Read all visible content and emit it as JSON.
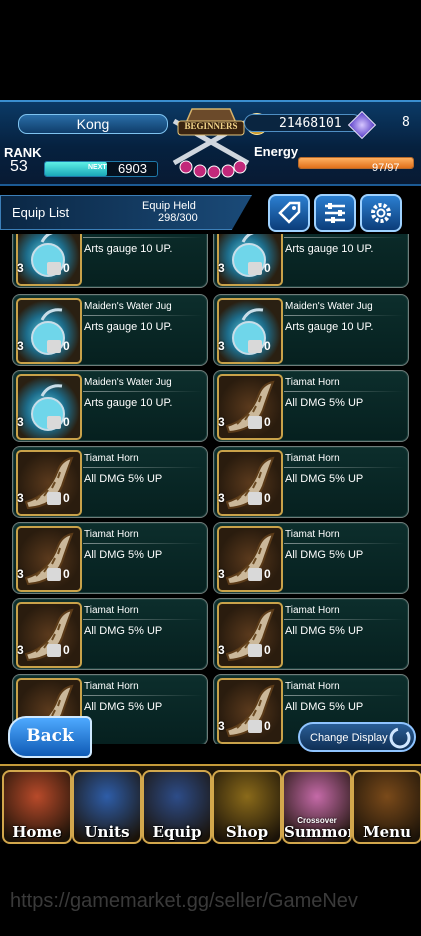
{
  "player": {
    "name": "Kong",
    "gil": "21468101",
    "lapis": "8",
    "rank_label": "RANK",
    "rank": "53",
    "next_label": "NEXT",
    "next_exp": "6903",
    "energy_label": "Energy",
    "energy": "97/97",
    "exp_progress": 0.55,
    "energy_progress": 1.0
  },
  "emblem": {
    "text": "BEGINNERS"
  },
  "list": {
    "title": "Equip List",
    "held_label": "Equip Held",
    "held_value": "298/300"
  },
  "toolbar": {
    "tag_icon": "tag-icon",
    "filter_icon": "filter-icon",
    "settings_icon": "gear-icon"
  },
  "items": [
    {
      "name": "",
      "desc": "Arts gauge 10 UP.",
      "count": "3",
      "locked": "0",
      "kind": "jug"
    },
    {
      "name": "",
      "desc": "Arts gauge 10 UP.",
      "count": "3",
      "locked": "0",
      "kind": "jug"
    },
    {
      "name": "Maiden's Water Jug",
      "desc": "Arts gauge 10 UP.",
      "count": "3",
      "locked": "0",
      "kind": "jug"
    },
    {
      "name": "Maiden's Water Jug",
      "desc": "Arts gauge 10 UP.",
      "count": "3",
      "locked": "0",
      "kind": "jug"
    },
    {
      "name": "Maiden's Water Jug",
      "desc": "Arts gauge 10 UP.",
      "count": "3",
      "locked": "0",
      "kind": "jug"
    },
    {
      "name": "Tiamat Horn",
      "desc": "All DMG 5% UP",
      "count": "3",
      "locked": "0",
      "kind": "horn"
    },
    {
      "name": "Tiamat Horn",
      "desc": "All DMG 5% UP",
      "count": "3",
      "locked": "0",
      "kind": "horn"
    },
    {
      "name": "Tiamat Horn",
      "desc": "All DMG 5% UP",
      "count": "3",
      "locked": "0",
      "kind": "horn"
    },
    {
      "name": "Tiamat Horn",
      "desc": "All DMG 5% UP",
      "count": "3",
      "locked": "0",
      "kind": "horn"
    },
    {
      "name": "Tiamat Horn",
      "desc": "All DMG 5% UP",
      "count": "3",
      "locked": "0",
      "kind": "horn"
    },
    {
      "name": "Tiamat Horn",
      "desc": "All DMG 5% UP",
      "count": "3",
      "locked": "0",
      "kind": "horn"
    },
    {
      "name": "Tiamat Horn",
      "desc": "All DMG 5% UP",
      "count": "3",
      "locked": "0",
      "kind": "horn"
    },
    {
      "name": "Tiamat Horn",
      "desc": "All DMG 5% UP",
      "count": "3",
      "locked": "0",
      "kind": "horn"
    },
    {
      "name": "Tiamat Horn",
      "desc": "All DMG 5% UP",
      "count": "3",
      "locked": "0",
      "kind": "horn"
    }
  ],
  "actions": {
    "back": "Back",
    "change_display": "Change Display"
  },
  "nav": [
    {
      "label": "Home",
      "color": "#b84a2a"
    },
    {
      "label": "Units",
      "color": "#2e5da8"
    },
    {
      "label": "Equip",
      "color": "#2d4c88"
    },
    {
      "label": "Shop",
      "color": "#8a6a1a"
    },
    {
      "label": "Summon",
      "color": "#c56aa8",
      "badge": "Crossover"
    },
    {
      "label": "Menu",
      "color": "#7a4a1a"
    }
  ],
  "watermark": "https://gamemarket.gg/seller/GameNev"
}
